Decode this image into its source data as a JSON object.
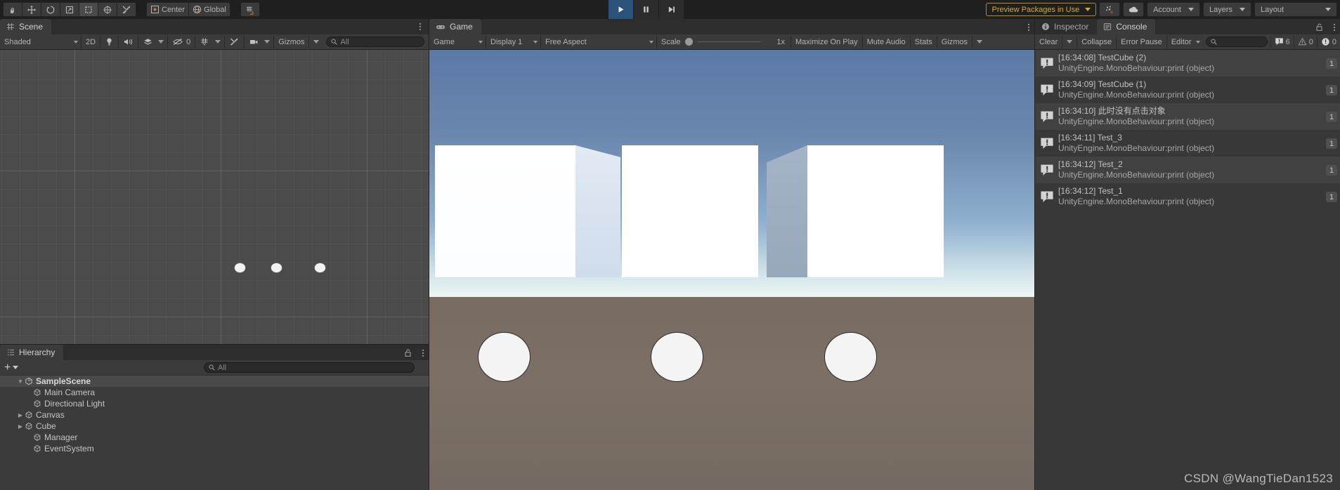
{
  "toolbar": {
    "tools": [
      {
        "name": "hand-tool",
        "label": ""
      },
      {
        "name": "move-tool",
        "label": ""
      },
      {
        "name": "rotate-tool",
        "label": ""
      },
      {
        "name": "scale-tool",
        "label": ""
      },
      {
        "name": "rect-tool",
        "label": ""
      },
      {
        "name": "transform-tool",
        "label": ""
      },
      {
        "name": "custom-editor-tool",
        "label": ""
      }
    ],
    "pivot_label": "Center",
    "handle_label": "Global",
    "snap_label": "",
    "play_label": "Play",
    "pause_label": "Pause",
    "step_label": "Step",
    "preview_packages": "Preview Packages in Use",
    "account_label": "Account",
    "layers_label": "Layers",
    "layout_label": "Layout"
  },
  "scene": {
    "tab_label": "Scene",
    "draw_mode": "Shaded",
    "mode_2d": "2D",
    "hidden_count": "0",
    "gizmos_label": "Gizmos",
    "search_placeholder": "All",
    "search_value": ""
  },
  "hierarchy": {
    "tab_label": "Hierarchy",
    "add_label": "+",
    "search_placeholder": "All",
    "search_value": "",
    "items": [
      {
        "label": "SampleScene",
        "depth": 0,
        "arrow": "down",
        "icon": "scene-icon",
        "selected": true
      },
      {
        "label": "Main Camera",
        "depth": 1,
        "arrow": "none",
        "icon": "gameobject-icon",
        "selected": false
      },
      {
        "label": "Directional Light",
        "depth": 1,
        "arrow": "none",
        "icon": "gameobject-icon",
        "selected": false
      },
      {
        "label": "Canvas",
        "depth": 1,
        "arrow": "right",
        "icon": "gameobject-icon",
        "selected": false
      },
      {
        "label": "Cube",
        "depth": 1,
        "arrow": "right",
        "icon": "gameobject-icon",
        "selected": false
      },
      {
        "label": "Manager",
        "depth": 1,
        "arrow": "none",
        "icon": "gameobject-icon",
        "selected": false
      },
      {
        "label": "EventSystem",
        "depth": 1,
        "arrow": "none",
        "icon": "gameobject-icon",
        "selected": false
      }
    ]
  },
  "game": {
    "tab_label": "Game",
    "mode_label": "Game",
    "display_label": "Display 1",
    "aspect_label": "Free Aspect",
    "scale_label": "Scale",
    "scale_value": "1x",
    "maximize_label": "Maximize On Play",
    "mute_label": "Mute Audio",
    "stats_label": "Stats",
    "gizmos_label": "Gizmos",
    "buttons": [
      {
        "name": "game-circle-button-1"
      },
      {
        "name": "game-circle-button-2"
      },
      {
        "name": "game-circle-button-3"
      }
    ]
  },
  "inspector": {
    "tab_label": "Inspector"
  },
  "console": {
    "tab_label": "Console",
    "clear_label": "Clear",
    "collapse_label": "Collapse",
    "error_pause_label": "Error Pause",
    "editor_label": "Editor",
    "search_placeholder": "",
    "search_value": "",
    "counts": {
      "log": "6",
      "warning": "0",
      "error": "0"
    },
    "entries": [
      {
        "line1": "[16:34:08] TestCube (2)",
        "line2": "UnityEngine.MonoBehaviour:print (object)",
        "count": "1"
      },
      {
        "line1": "[16:34:09] TestCube (1)",
        "line2": "UnityEngine.MonoBehaviour:print (object)",
        "count": "1"
      },
      {
        "line1": "[16:34:10] 此时没有点击对象",
        "line2": "UnityEngine.MonoBehaviour:print (object)",
        "count": "1"
      },
      {
        "line1": "[16:34:11] Test_3",
        "line2": "UnityEngine.MonoBehaviour:print (object)",
        "count": "1"
      },
      {
        "line1": "[16:34:12] Test_2",
        "line2": "UnityEngine.MonoBehaviour:print (object)",
        "count": "1"
      },
      {
        "line1": "[16:34:12] Test_1",
        "line2": "UnityEngine.MonoBehaviour:print (object)",
        "count": "1"
      }
    ]
  },
  "watermark": "CSDN @WangTieDan1523",
  "colors": {
    "accent_blue": "#2b5278",
    "preview_yellow": "#e0a820",
    "panel_bg": "#3b3b3b",
    "toolbar_bg": "#1f1f1f",
    "scene_bg": "#4b4b4b",
    "sky_top": "#5b79a5",
    "ground": "#786c62"
  }
}
